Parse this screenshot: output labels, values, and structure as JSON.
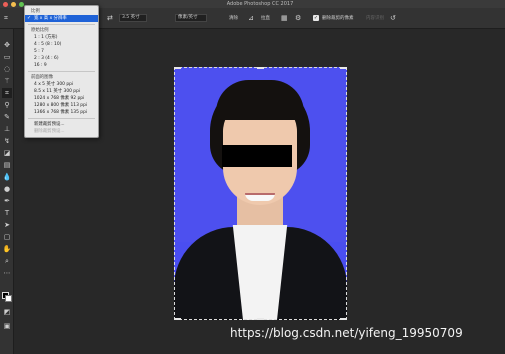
{
  "window": {
    "title": "Adobe Photoshop CC 2017"
  },
  "options_bar": {
    "ratio_value": "3.5 英寸",
    "resolution_unit": "像素/英寸",
    "clear_label": "清除",
    "straighten_label": "拉直",
    "delete_cropped_label": "删除裁剪的像素",
    "content_aware_label": "内容识别"
  },
  "crop_menu": {
    "header": "比例",
    "selected": "宽 x 高 x 分辨率",
    "preset_header": "原始比例",
    "presets": [
      "1 : 1 (方形)",
      "4 : 5 (8 : 10)",
      "5 : 7",
      "2 : 3 (4 : 6)",
      "16 : 9"
    ],
    "front_image_header": "前面的图像",
    "front_images": [
      "4 x 5 英寸 300 ppi",
      "8.5 x 11 英寸 300 ppi",
      "1024 x 768 像素 92 ppi",
      "1280 x 800 像素 113 ppi",
      "1366 x 768 像素 135 ppi"
    ],
    "new_preset": "新建裁剪预设...",
    "delete_preset": "删除裁剪预设..."
  },
  "watermark": "https://blog.csdn.net/yifeng_19950709",
  "colors": {
    "ui_bg": "#282828",
    "panel_bg": "#333333",
    "photo_bg": "#4a4ef0",
    "menu_bg": "#e8e8e8",
    "selection": "#1e62d7"
  },
  "icons": [
    "crop-icon",
    "move-icon",
    "marquee-icon",
    "lasso-icon",
    "magic-wand-icon",
    "eyedropper-icon",
    "brush-icon",
    "stamp-icon",
    "history-brush-icon",
    "eraser-icon",
    "gradient-icon",
    "blur-icon",
    "dodge-icon",
    "pen-icon",
    "text-icon",
    "path-select-icon",
    "shape-icon",
    "hand-icon",
    "zoom-icon",
    "reset-icon",
    "gear-icon",
    "grid-icon",
    "rotate-icon",
    "swap-icon"
  ]
}
